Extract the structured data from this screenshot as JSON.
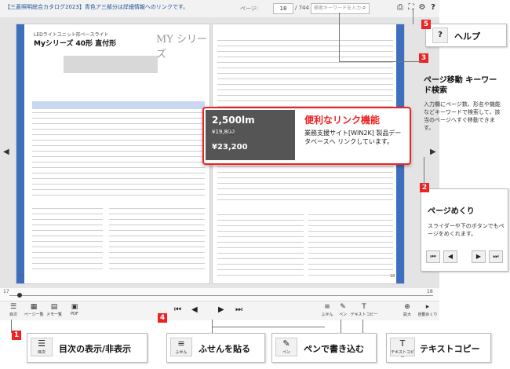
{
  "topbar": {
    "notice": "【三菱照明総合カタログ2023】青色ア三部分は詳細情報へのリンクです。",
    "page_label": "ページ:",
    "page_value": "18",
    "page_total": "/ 744",
    "search_placeholder": "検索キーワードを入力"
  },
  "catalog": {
    "left_subtitle": "LEDライトユニット形ベースライト",
    "left_title": "Myシリーズ 40形 直付形",
    "logo": "MY シリーズ",
    "page_left": "17",
    "page_right": "18"
  },
  "popup": {
    "lumen": "2,500lm",
    "price1": "¥19,800",
    "price2": "¥23,200",
    "title": "便利なリンク機能",
    "desc": "業務支援サイト[WIN2K] 製品データベースへ リンクしています。"
  },
  "slider": {
    "left": "17",
    "right": "18"
  },
  "toolbar": {
    "toc": "目次",
    "page_list": "ページ一覧",
    "memo_list": "メモ一覧",
    "pdf": "PDF",
    "sticky": "ふせん",
    "pen": "ペン",
    "text_copy": "テキストコピー",
    "zoom": "拡大",
    "auto_turn": "自動めくり"
  },
  "callouts": {
    "help_num": "5",
    "help": "ヘルプ",
    "search_num": "3",
    "search_title": "ページ移動 キーワード検索",
    "search_desc": "入力欄にページ数、形名や機能などキーワードで検索して、該当のページへすぐ移動できます。",
    "page_num": "2",
    "page_title": "ページめくり",
    "page_desc": "スライダーや下のボタンでもページをめくれます。",
    "toc_num": "1",
    "toc": "目次の表示/非表示",
    "toc_icon_label": "目次",
    "sticky_num": "4",
    "sticky": "ふせんを貼る",
    "sticky_icon_label": "ふせん",
    "pen": "ペンで書き込む",
    "pen_icon_label": "ペン",
    "copy": "テキストコピー",
    "copy_icon_label": "テキストコピー"
  }
}
